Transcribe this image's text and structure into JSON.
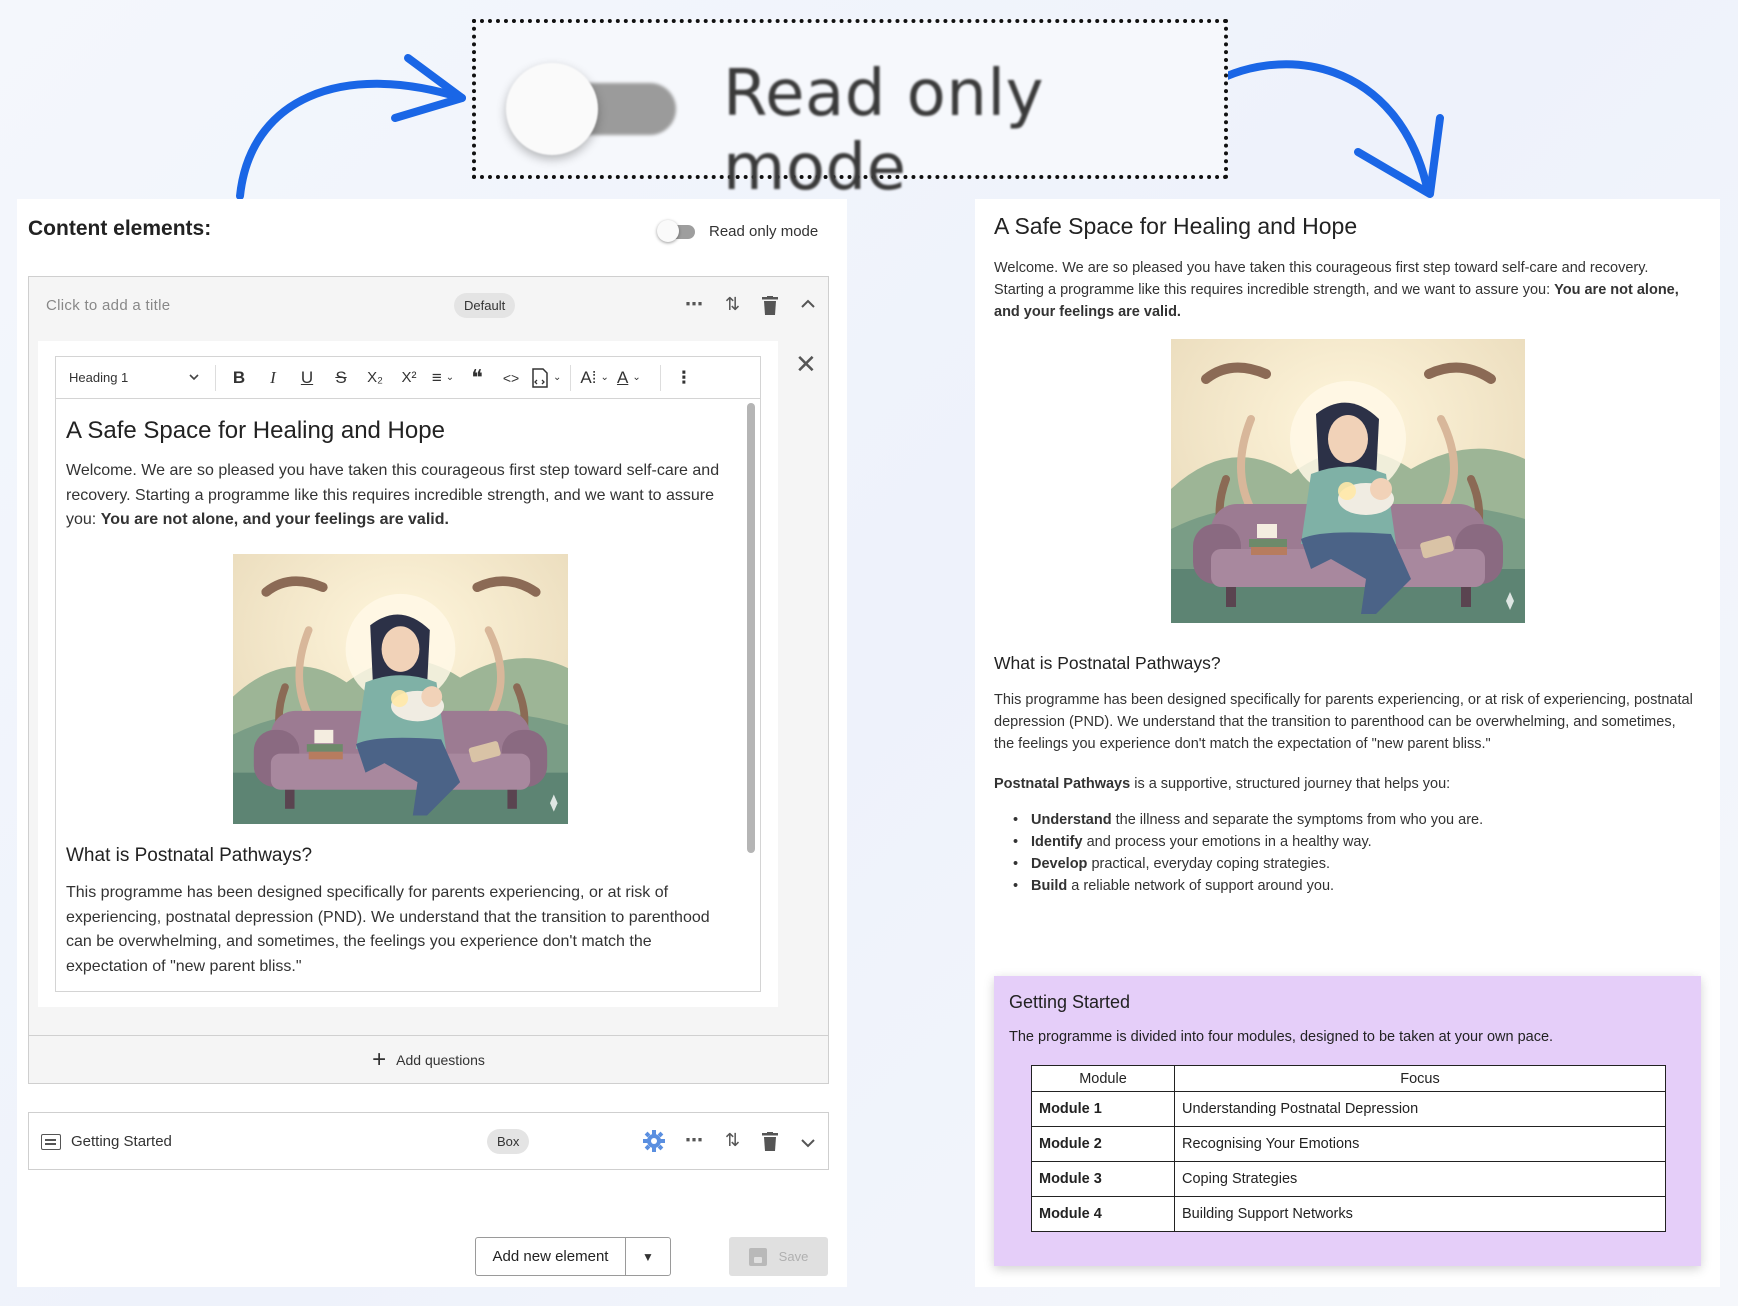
{
  "callout": {
    "label": "Read only mode"
  },
  "left_panel": {
    "title": "Content elements:",
    "read_only_label": "Read only mode",
    "element": {
      "title_placeholder": "Click to add a title",
      "style_chip": "Default",
      "toolbar": {
        "block_style": "Heading 1",
        "bold": "B",
        "italic": "I",
        "underline": "U",
        "strike": "S",
        "subscript": "X₂",
        "superscript": "X²",
        "align": "≡",
        "quote": "❝",
        "code": "<>",
        "font_size": "A⁞",
        "font_color": "A"
      },
      "content": {
        "heading": "A Safe Space for Healing and Hope",
        "intro": "Welcome. We are so pleased you have taken this courageous first step toward self-care and recovery. Starting a programme like this requires incredible strength, and we want to assure you:",
        "intro_bold": "You are not alone, and your feelings are valid.",
        "subheading": "What is Postnatal Pathways?",
        "body": "This programme has been designed specifically for parents experiencing, or at risk of experiencing, postnatal depression (PND). We understand that the transition to parenthood can be overwhelming, and sometimes, the feelings you experience don't match the expectation of \"new parent bliss.\""
      },
      "add_questions": "Add questions"
    },
    "box_element": {
      "label": "Getting Started",
      "chip": "Box"
    },
    "add_new_element": "Add new element",
    "save": "Save"
  },
  "right_panel": {
    "heading": "A Safe Space for Healing and Hope",
    "intro": "Welcome. We are so pleased you have taken this courageous first step toward self-care and recovery. Starting a programme like this requires incredible strength, and we want to assure you:",
    "intro_bold": "You are not alone, and your feelings are valid.",
    "subheading": "What is Postnatal Pathways?",
    "body": "This programme has been designed specifically for parents experiencing, or at risk of experiencing, postnatal depression (PND). We understand that the transition to parenthood can be overwhelming, and sometimes, the feelings you experience don't match the expectation of \"new parent bliss.\"",
    "pathways_bold": "Postnatal Pathways",
    "pathways_rest": "is a supportive, structured journey that helps you:",
    "bullets": [
      {
        "bold": "Understand",
        "rest": "the illness and separate the symptoms from who you are."
      },
      {
        "bold": "Identify",
        "rest": "and process your emotions in a healthy way."
      },
      {
        "bold": "Develop",
        "rest": "practical, everyday coping strategies."
      },
      {
        "bold": "Build",
        "rest": "a reliable network of support around you."
      }
    ],
    "getting_started": {
      "title": "Getting Started",
      "description": "The programme is divided into four modules, designed to be taken at your own pace.",
      "headers": [
        "Module",
        "Focus"
      ],
      "rows": [
        [
          "Module 1",
          "Understanding Postnatal Depression"
        ],
        [
          "Module 2",
          "Recognising Your Emotions"
        ],
        [
          "Module 3",
          "Coping Strategies"
        ],
        [
          "Module 4",
          "Building Support Networks"
        ]
      ]
    }
  },
  "colors": {
    "arrow": "#1a66e6",
    "box_bg": "#e5cef9",
    "gear": "#5a8fe0"
  }
}
